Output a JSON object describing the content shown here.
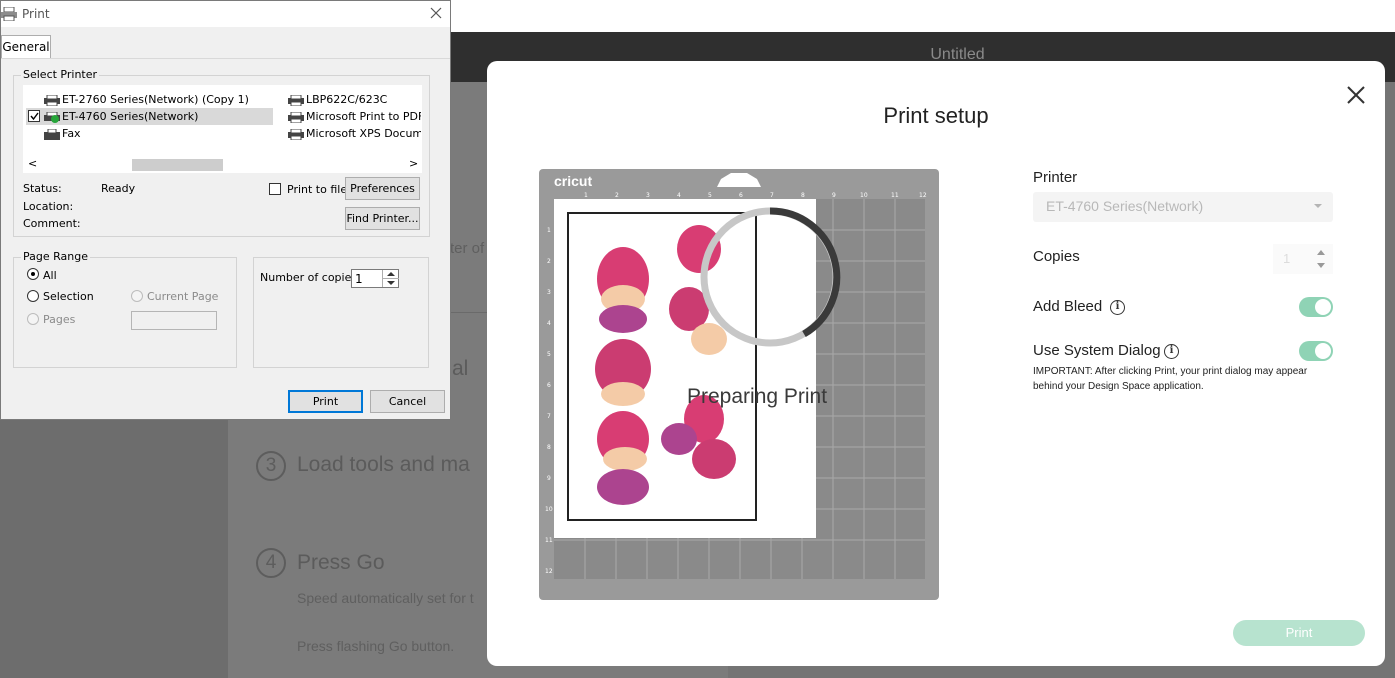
{
  "app": {
    "title": "Untitled",
    "peek_text": "ter of",
    "step2_tail": "al",
    "steps": [
      {
        "number": "3",
        "label": "Load tools and ma"
      },
      {
        "number": "4",
        "label": "Press Go"
      }
    ],
    "speed_text": "Speed automatically set for t",
    "press_text": "Press flashing Go button."
  },
  "print_setup": {
    "title": "Print setup",
    "mat_brand": "cricut",
    "preparing_label": "Preparing Print",
    "printer_label": "Printer",
    "printer_value": "ET-4760 Series(Network)",
    "copies_label": "Copies",
    "copies_value": "1",
    "add_bleed_label": "Add Bleed",
    "add_bleed_on": true,
    "system_dialog_label": "Use System Dialog",
    "system_dialog_on": true,
    "note_text": "IMPORTANT: After clicking Print, your print dialog may appear behind your Design Space application.",
    "print_button": "Print",
    "accent_color": "#8fd3b5"
  },
  "win_print": {
    "title": "Print",
    "tab_general": "General",
    "select_printer_label": "Select Printer",
    "printers": [
      {
        "name": "ET-2760 Series(Network) (Copy 1)",
        "icon": "printer-icon"
      },
      {
        "name": "ET-4760 Series(Network)",
        "icon": "printer-default-icon"
      },
      {
        "name": "Fax",
        "icon": "fax-icon"
      },
      {
        "name": "LBP622C/623C",
        "icon": "printer-icon"
      },
      {
        "name": "Microsoft Print to PDF",
        "icon": "printer-icon"
      },
      {
        "name": "Microsoft XPS Document Writer",
        "icon": "printer-icon"
      }
    ],
    "scroll_left": "<",
    "scroll_right": ">",
    "status_label": "Status:",
    "status_value": "Ready",
    "location_label": "Location:",
    "comment_label": "Comment:",
    "print_to_file_label": "Print to file",
    "preferences_button": "Preferences",
    "find_printer_button": "Find Printer...",
    "page_range_label": "Page Range",
    "range_all": "All",
    "range_selection": "Selection",
    "range_current_page": "Current Page",
    "range_pages": "Pages",
    "copies_label": "Number of copies:",
    "copies_value": "1",
    "print_button": "Print",
    "cancel_button": "Cancel"
  }
}
